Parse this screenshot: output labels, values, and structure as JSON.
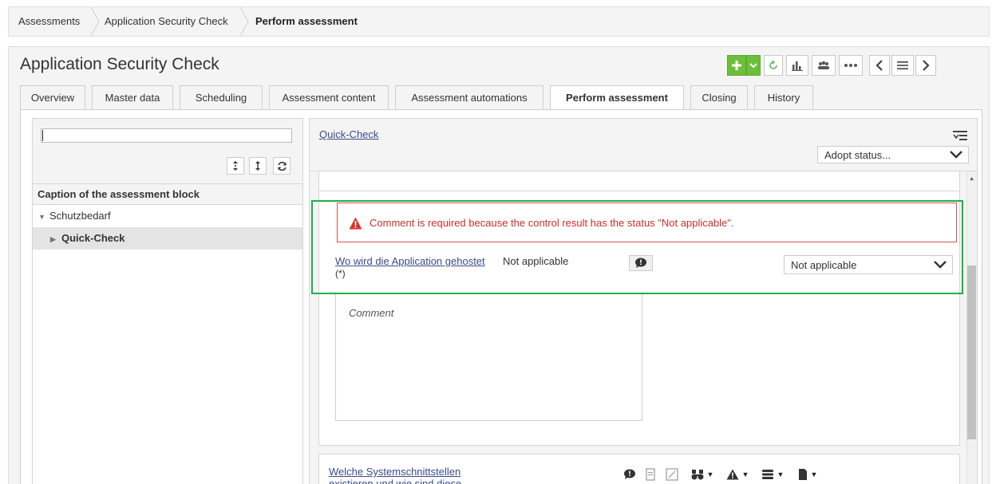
{
  "breadcrumb": {
    "items": [
      "Assessments",
      "Application Security Check",
      "Perform assessment"
    ]
  },
  "page": {
    "title": "Application Security Check"
  },
  "tabs": [
    {
      "label": "Overview"
    },
    {
      "label": "Master data"
    },
    {
      "label": "Scheduling"
    },
    {
      "label": "Assessment content"
    },
    {
      "label": "Assessment automations"
    },
    {
      "label": "Perform assessment",
      "active": true
    },
    {
      "label": "Closing"
    },
    {
      "label": "History"
    }
  ],
  "toolbar": {
    "icons": [
      "add-icon",
      "chevron-down-icon",
      "refresh-icon",
      "bar-chart-icon",
      "users-icon",
      "more-icon",
      "previous-icon",
      "list-icon",
      "next-icon"
    ]
  },
  "left_panel": {
    "search_value": "",
    "caption_header": "Caption of the assessment block",
    "tree": [
      {
        "label": "Schutzbedarf",
        "expanded": true
      },
      {
        "label": "Quick-Check",
        "selected": true
      }
    ]
  },
  "right_panel": {
    "block_link": "Quick-Check",
    "adopt_status_placeholder": "Adopt status...",
    "error_message": "Comment is required because the control result has the status \"Not applicable\".",
    "question": {
      "label": "Wo wird die Application gehostet",
      "required_marker": "(*)",
      "status_text": "Not applicable",
      "selected_status": "Not applicable",
      "comment_placeholder": "Comment"
    },
    "next_question": {
      "label": "Welche Systemschnittstellen existieren und wie sind diese"
    }
  },
  "colors": {
    "accent_green": "#6cbf3a",
    "highlight_border": "#1ab24b",
    "error_red": "#c9302c",
    "link": "#3a4a8a"
  }
}
